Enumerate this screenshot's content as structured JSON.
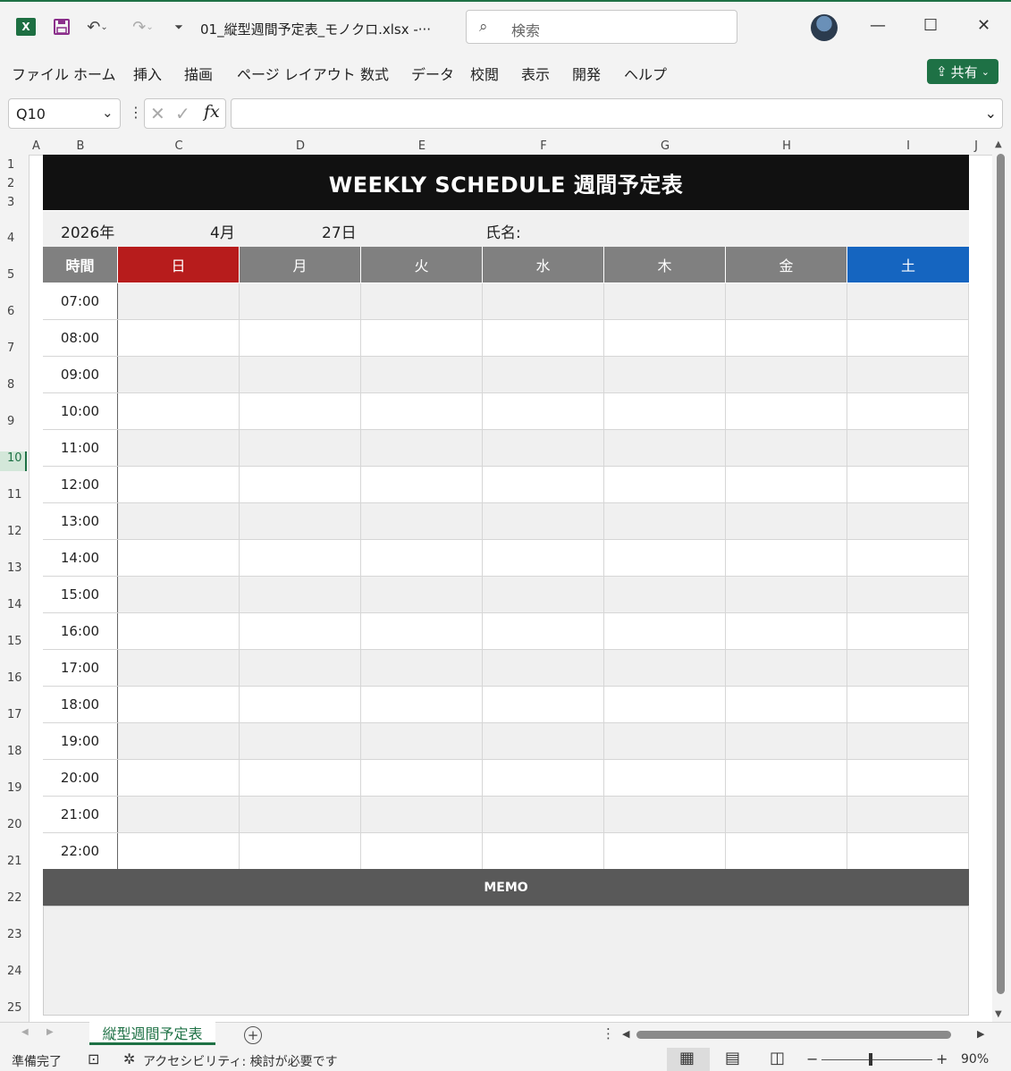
{
  "titlebar": {
    "file_name": "01_縦型週間予定表_モノクロ.xlsx  -···",
    "search_placeholder": "検索",
    "excel_logo": "X",
    "icons": [
      "save-icon",
      "undo-icon",
      "redo-icon",
      "customize-icon"
    ]
  },
  "menu": {
    "items": [
      "ファイル",
      "ホーム",
      "挿入",
      "描画",
      "ページ レイアウト",
      "数式",
      "データ",
      "校閲",
      "表示",
      "開発",
      "ヘルプ"
    ],
    "share_label": "共有"
  },
  "formula_bar": {
    "name_box": "Q10",
    "fx": "fx",
    "value": ""
  },
  "columns": [
    "A",
    "B",
    "C",
    "D",
    "E",
    "F",
    "G",
    "H",
    "I",
    "J"
  ],
  "rows": [
    "1",
    "2",
    "3",
    "4",
    "5",
    "6",
    "7",
    "8",
    "9",
    "10",
    "11",
    "12",
    "13",
    "14",
    "15",
    "16",
    "17",
    "18",
    "19",
    "20",
    "21",
    "22",
    "23",
    "24",
    "25"
  ],
  "sheet": {
    "title": "WEEKLY SCHEDULE  週間予定表",
    "year": "2026年",
    "month": "4月",
    "day": "27日",
    "name_label": "氏名:",
    "time_header": "時間",
    "days": [
      {
        "label": "日",
        "color": "#b71c1c"
      },
      {
        "label": "月",
        "color": "#808080"
      },
      {
        "label": "火",
        "color": "#808080"
      },
      {
        "label": "水",
        "color": "#808080"
      },
      {
        "label": "木",
        "color": "#808080"
      },
      {
        "label": "金",
        "color": "#808080"
      },
      {
        "label": "土",
        "color": "#1565c0"
      }
    ],
    "times": [
      "07:00",
      "08:00",
      "09:00",
      "10:00",
      "11:00",
      "12:00",
      "13:00",
      "14:00",
      "15:00",
      "16:00",
      "17:00",
      "18:00",
      "19:00",
      "20:00",
      "21:00",
      "22:00"
    ],
    "memo_label": "MEMO"
  },
  "tabs": {
    "active": "縦型週間予定表"
  },
  "status": {
    "ready": "準備完了",
    "accessibility": "アクセシビリティ: 検討が必要です",
    "zoom": "90%"
  }
}
